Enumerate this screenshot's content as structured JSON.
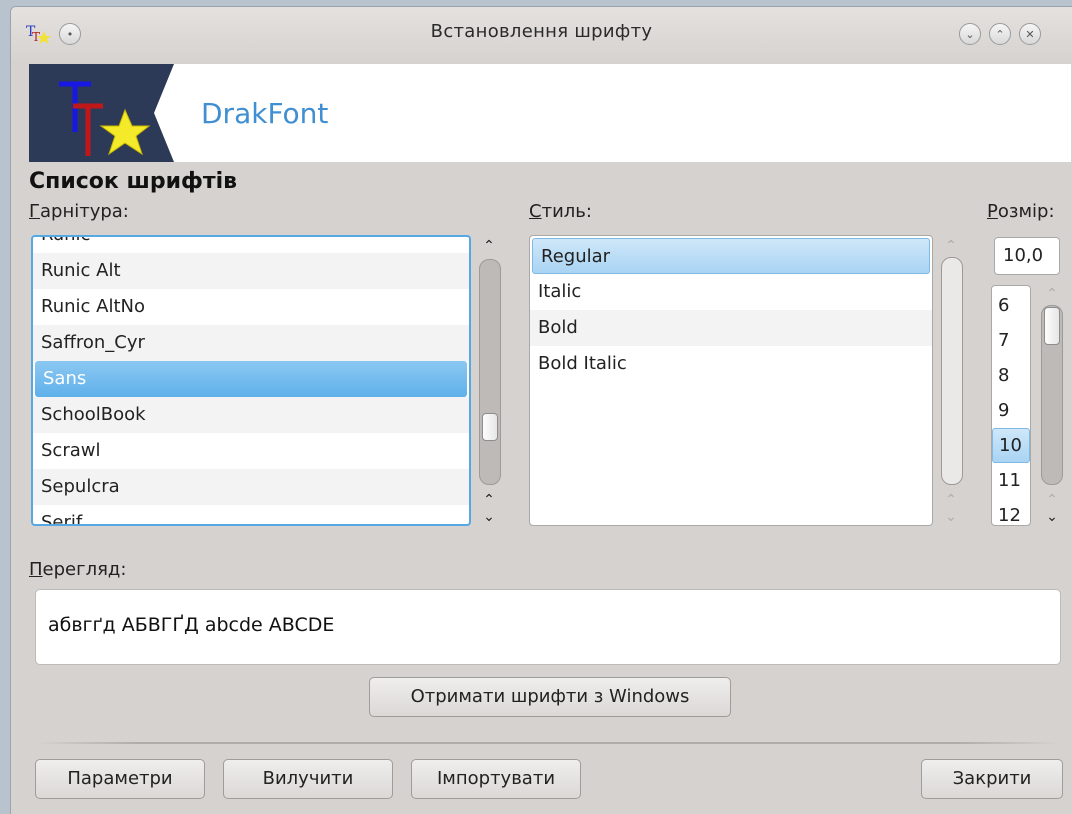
{
  "window": {
    "title": "Встановлення шрифту"
  },
  "banner": {
    "app_name": "DrakFont"
  },
  "section_title": "Список шрифтів",
  "family": {
    "label_first": "Г",
    "label_rest": "арнітура:",
    "items": [
      "Runic",
      "Runic Alt",
      "Runic AltNo",
      "Saffron_Cyr",
      "Sans",
      "SchoolBook",
      "Scrawl",
      "Sepulcra",
      "Serif"
    ],
    "selected": "Sans"
  },
  "style": {
    "label_first": "С",
    "label_rest": "тиль:",
    "items": [
      "Regular",
      "Italic",
      "Bold",
      "Bold Italic"
    ],
    "selected": "Regular"
  },
  "size": {
    "label_first": "Р",
    "label_rest": "озмір:",
    "value": "10,0",
    "items": [
      "6",
      "7",
      "8",
      "9",
      "10",
      "11",
      "12"
    ],
    "selected": "10"
  },
  "preview": {
    "label_first": "П",
    "label_rest": "ерегляд:",
    "text": "абвгґд АБВГҐД abcde ABCDE"
  },
  "buttons": {
    "get_windows_fonts": "Отримати шрифти з Windows",
    "options": "Параметри",
    "remove": "Вилучити",
    "import": "Імпортувати",
    "close": "Закрити"
  },
  "colors": {
    "selection": "#5fb0ea",
    "focus_border": "#56a8e3",
    "banner_text": "#3f8fd2",
    "logo_bg": "#2d3a57"
  }
}
